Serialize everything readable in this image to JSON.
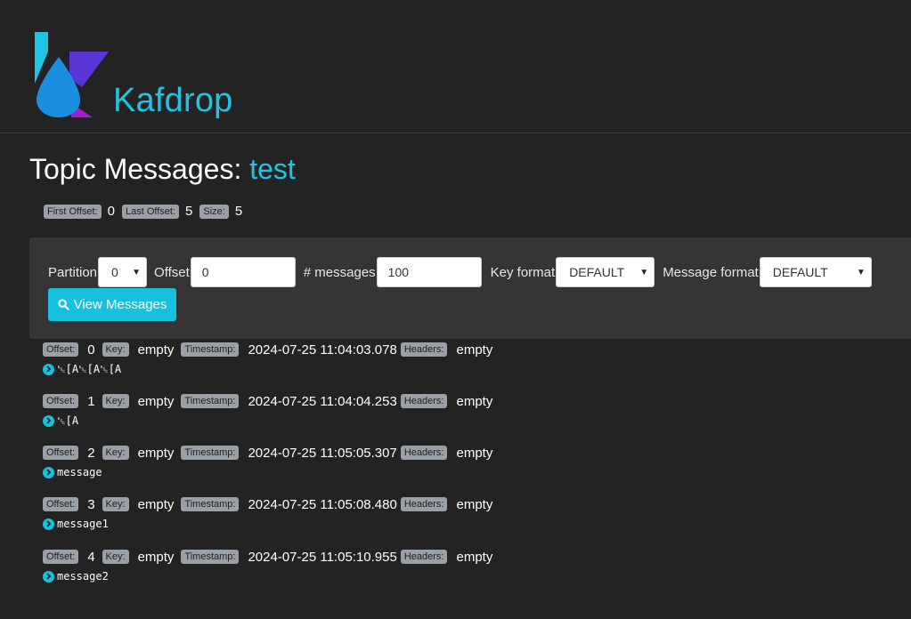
{
  "brand": {
    "name": "Kafdrop"
  },
  "title": {
    "prefix": "Topic Messages:",
    "topic": "test"
  },
  "summary": {
    "first_offset_label": "First Offset:",
    "first_offset": "0",
    "last_offset_label": "Last Offset:",
    "last_offset": "5",
    "size_label": "Size:",
    "size": "5"
  },
  "form": {
    "partition_label": "Partition",
    "partition_value": "0",
    "offset_label": "Offset",
    "offset_value": "0",
    "messages_label": "# messages",
    "messages_value": "100",
    "key_format_label": "Key format",
    "key_format_value": "DEFAULT",
    "message_format_label": "Message format",
    "message_format_value": "DEFAULT",
    "view_button": "View Messages"
  },
  "labels": {
    "offset": "Offset:",
    "key": "Key:",
    "timestamp": "Timestamp:",
    "headers": "Headers:"
  },
  "messages": [
    {
      "offset": "0",
      "key": "empty",
      "timestamp": "2024-07-25 11:04:03.078",
      "headers": "empty",
      "value": "␛[A␛[A␛[A"
    },
    {
      "offset": "1",
      "key": "empty",
      "timestamp": "2024-07-25 11:04:04.253",
      "headers": "empty",
      "value": "␛[A"
    },
    {
      "offset": "2",
      "key": "empty",
      "timestamp": "2024-07-25 11:05:05.307",
      "headers": "empty",
      "value": "message"
    },
    {
      "offset": "3",
      "key": "empty",
      "timestamp": "2024-07-25 11:05:08.480",
      "headers": "empty",
      "value": "message1"
    },
    {
      "offset": "4",
      "key": "empty",
      "timestamp": "2024-07-25 11:05:10.955",
      "headers": "empty",
      "value": "message2"
    }
  ],
  "colors": {
    "accent": "#1ec4e3",
    "background": "#232323",
    "panel": "#353535",
    "badge": "#9aa0a6"
  }
}
